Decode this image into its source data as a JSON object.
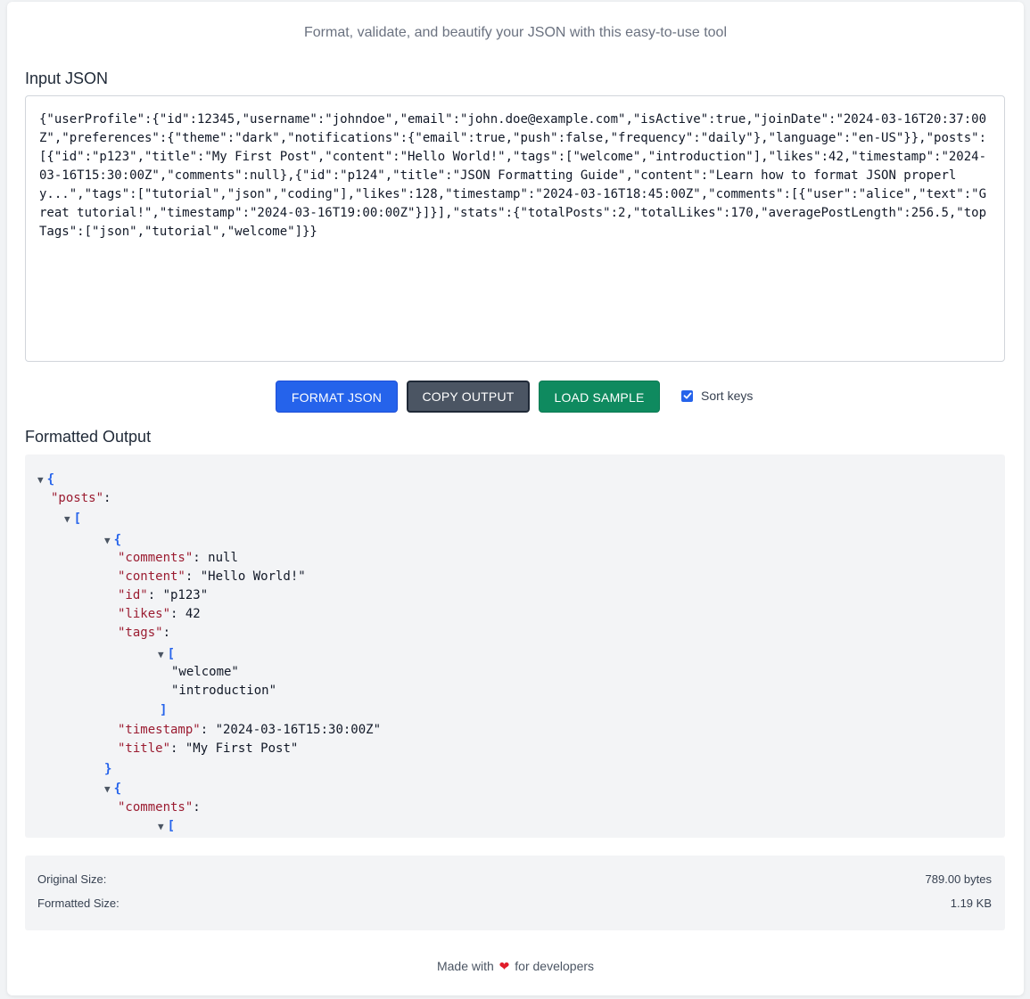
{
  "header": {
    "subtitle": "Format, validate, and beautify your JSON with this easy-to-use tool"
  },
  "input": {
    "label": "Input JSON",
    "value": "{\"userProfile\":{\"id\":12345,\"username\":\"johndoe\",\"email\":\"john.doe@example.com\",\"isActive\":true,\"joinDate\":\"2024-03-16T20:37:00Z\",\"preferences\":{\"theme\":\"dark\",\"notifications\":{\"email\":true,\"push\":false,\"frequency\":\"daily\"},\"language\":\"en-US\"}},\"posts\":[{\"id\":\"p123\",\"title\":\"My First Post\",\"content\":\"Hello World!\",\"tags\":[\"welcome\",\"introduction\"],\"likes\":42,\"timestamp\":\"2024-03-16T15:30:00Z\",\"comments\":null},{\"id\":\"p124\",\"title\":\"JSON Formatting Guide\",\"content\":\"Learn how to format JSON properly...\",\"tags\":[\"tutorial\",\"json\",\"coding\"],\"likes\":128,\"timestamp\":\"2024-03-16T18:45:00Z\",\"comments\":[{\"user\":\"alice\",\"text\":\"Great tutorial!\",\"timestamp\":\"2024-03-16T19:00:00Z\"}]}],\"stats\":{\"totalPosts\":2,\"totalLikes\":170,\"averagePostLength\":256.5,\"topTags\":[\"json\",\"tutorial\",\"welcome\"]}}"
  },
  "toolbar": {
    "format_label": "FORMAT JSON",
    "copy_label": "COPY OUTPUT",
    "load_label": "LOAD SAMPLE",
    "sort_keys_label": "Sort keys",
    "sort_keys_checked": true
  },
  "output": {
    "label": "Formatted Output",
    "lines": [
      {
        "toggle": "▼",
        "open": "{"
      },
      {
        "key": "\"posts\"",
        "sep": ":"
      },
      {
        "toggle": "▼",
        "open": "["
      },
      {
        "toggle": "▼",
        "open": "{"
      },
      {
        "key": "\"comments\"",
        "sep": ": ",
        "value": "null"
      },
      {
        "key": "\"content\"",
        "sep": ": ",
        "value": "\"Hello World!\""
      },
      {
        "key": "\"id\"",
        "sep": ": ",
        "value": "\"p123\""
      },
      {
        "key": "\"likes\"",
        "sep": ": ",
        "value": "42"
      },
      {
        "key": "\"tags\"",
        "sep": ":"
      },
      {
        "toggle": "▼",
        "open": "["
      },
      {
        "value": "\"welcome\""
      },
      {
        "value": "\"introduction\""
      },
      {
        "close": "]"
      },
      {
        "key": "\"timestamp\"",
        "sep": ": ",
        "value": "\"2024-03-16T15:30:00Z\""
      },
      {
        "key": "\"title\"",
        "sep": ": ",
        "value": "\"My First Post\""
      },
      {
        "close": "}"
      },
      {
        "toggle": "▼",
        "open": "{"
      },
      {
        "key": "\"comments\"",
        "sep": ":"
      },
      {
        "toggle": "▼",
        "open": "["
      }
    ]
  },
  "stats": {
    "original_label": "Original Size:",
    "original_value": "789.00 bytes",
    "formatted_label": "Formatted Size:",
    "formatted_value": "1.19 KB"
  },
  "footer": {
    "prefix": "Made with",
    "heart": "❤",
    "suffix": "for developers"
  },
  "colors": {
    "primary": "#2563eb",
    "secondary": "#4b5563",
    "success": "#0f8a5f",
    "key": "#9b1c31"
  }
}
